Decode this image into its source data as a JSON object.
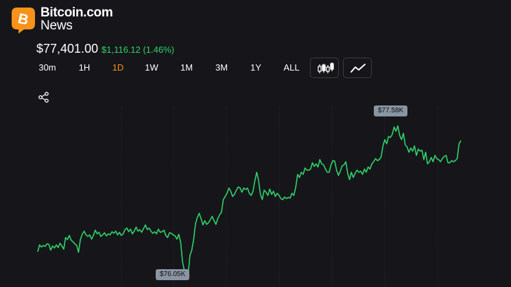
{
  "brand": {
    "name": "Bitcoin.com",
    "sub": "News"
  },
  "ticker": {
    "price": "$77,401.00",
    "change": "$1,116.12 (1.46%)"
  },
  "colors": {
    "accent": "#f7931a",
    "up": "#2fd36b",
    "line": "#2fd36b",
    "low_marker": "#ff3b3b",
    "bg": "#16161a"
  },
  "timeframes": [
    {
      "label": "30m",
      "active": false
    },
    {
      "label": "1H",
      "active": false
    },
    {
      "label": "1D",
      "active": true
    },
    {
      "label": "1W",
      "active": false
    },
    {
      "label": "1M",
      "active": false
    },
    {
      "label": "3M",
      "active": false
    },
    {
      "label": "1Y",
      "active": false
    },
    {
      "label": "ALL",
      "active": false
    }
  ],
  "chart_types": [
    {
      "icon": "candlestick-icon",
      "active": false
    },
    {
      "icon": "line-chart-icon",
      "active": true
    }
  ],
  "share_icon": "share-icon",
  "annotations": {
    "high": "$77.58K",
    "low": "$76.05K"
  },
  "chart_data": {
    "type": "line",
    "title": "",
    "xlabel": "",
    "ylabel": "",
    "grid": "vertical dotted",
    "ylim": [
      75950,
      77700
    ],
    "high": 77580,
    "low": 76050,
    "y": [
      76285,
      76350,
      76330,
      76345,
      76335,
      76360,
      76355,
      76300,
      76340,
      76320,
      76350,
      76325,
      76365,
      76340,
      76310,
      76420,
      76400,
      76440,
      76395,
      76380,
      76360,
      76345,
      76280,
      76400,
      76450,
      76480,
      76445,
      76430,
      76445,
      76405,
      76440,
      76490,
      76455,
      76470,
      76430,
      76445,
      76465,
      76435,
      76455,
      76445,
      76475,
      76460,
      76480,
      76445,
      76470,
      76440,
      76455,
      76495,
      76510,
      76475,
      76500,
      76455,
      76480,
      76520,
      76480,
      76495,
      76470,
      76505,
      76540,
      76495,
      76510,
      76480,
      76460,
      76475,
      76455,
      76500,
      76470,
      76475,
      76490,
      76440,
      76420,
      76465,
      76460,
      76445,
      76435,
      76405,
      76450,
      76375,
      76190,
      76105,
      76080,
      76060,
      76250,
      76300,
      76400,
      76550,
      76610,
      76650,
      76600,
      76540,
      76580,
      76545,
      76560,
      76590,
      76620,
      76580,
      76545,
      76600,
      76635,
      76660,
      76780,
      76810,
      76840,
      76890,
      76860,
      76810,
      76830,
      76870,
      76900,
      76890,
      76850,
      76890,
      76875,
      76890,
      76840,
      76820,
      76860,
      76960,
      77040,
      76960,
      76830,
      76780,
      76870,
      76850,
      76820,
      76880,
      76830,
      76860,
      76810,
      76840,
      76820,
      76790,
      76780,
      76805,
      76790,
      76800,
      76795,
      76840,
      76820,
      76900,
      77020,
      76990,
      77040,
      77020,
      77080,
      77060,
      77060,
      77070,
      77130,
      77095,
      77120,
      77090,
      77160,
      77120,
      77110,
      77070,
      77040,
      77040,
      77110,
      77150,
      77145,
      77060,
      77010,
      77050,
      77100,
      77110,
      77140,
      77030,
      76970,
      77040,
      76990,
      77030,
      77060,
      77040,
      77050,
      77020,
      77070,
      77040,
      77090,
      77070,
      77120,
      77140,
      77170,
      77150,
      77160,
      77185,
      77290,
      77350,
      77310,
      77380,
      77370,
      77400,
      77470,
      77430,
      77480,
      77390,
      77350,
      77410,
      77300,
      77280,
      77230,
      77270,
      77240,
      77290,
      77200,
      77260,
      77240,
      77250,
      77160,
      77230,
      77120,
      77140,
      77180,
      77140,
      77200,
      77170,
      77160,
      77140,
      77170,
      77190,
      77200,
      77130,
      77130,
      77150,
      77140,
      77150,
      77170,
      77310,
      77340
    ]
  }
}
